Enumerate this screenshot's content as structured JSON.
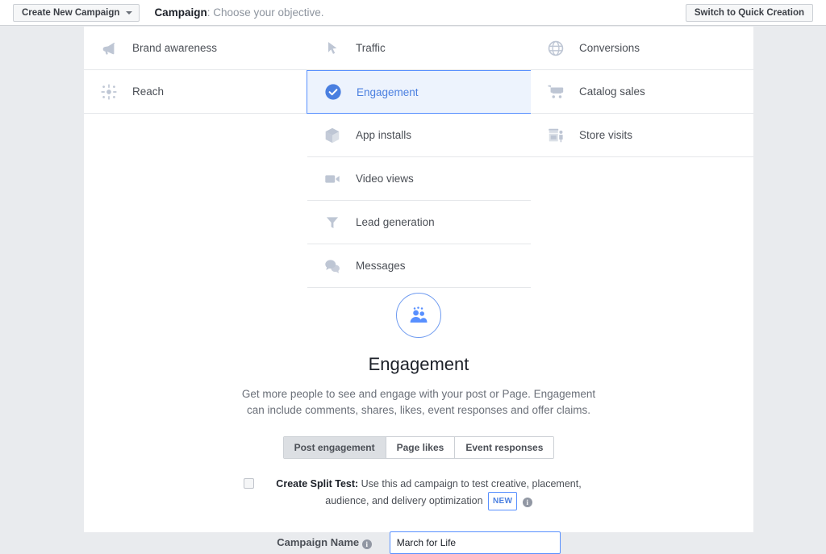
{
  "topbar": {
    "create_button": "Create New Campaign",
    "title_bold": "Campaign",
    "title_rest": ": Choose your objective.",
    "switch_button": "Switch to Quick Creation"
  },
  "objectives": {
    "column_1": [
      {
        "label": "Brand awareness",
        "icon": "megaphone-icon",
        "selected": false
      },
      {
        "label": "Reach",
        "icon": "starburst-icon",
        "selected": false
      }
    ],
    "column_2": [
      {
        "label": "Traffic",
        "icon": "cursor-icon",
        "selected": false
      },
      {
        "label": "Engagement",
        "icon": "check-circle-icon",
        "selected": true
      },
      {
        "label": "App installs",
        "icon": "cube-icon",
        "selected": false
      },
      {
        "label": "Video views",
        "icon": "video-camera-icon",
        "selected": false
      },
      {
        "label": "Lead generation",
        "icon": "funnel-icon",
        "selected": false
      },
      {
        "label": "Messages",
        "icon": "chat-bubbles-icon",
        "selected": false
      }
    ],
    "column_3": [
      {
        "label": "Conversions",
        "icon": "globe-icon",
        "selected": false
      },
      {
        "label": "Catalog sales",
        "icon": "shopping-cart-icon",
        "selected": false
      },
      {
        "label": "Store visits",
        "icon": "storefront-icon",
        "selected": false
      }
    ]
  },
  "detail": {
    "icon": "people-engagement-icon",
    "title": "Engagement",
    "description": "Get more people to see and engage with your post or Page. Engagement can include comments, shares, likes, event responses and offer claims.",
    "tabs": [
      {
        "label": "Post engagement",
        "active": true
      },
      {
        "label": "Page likes",
        "active": false
      },
      {
        "label": "Event responses",
        "active": false
      }
    ]
  },
  "split_test": {
    "checked": false,
    "label_bold": "Create Split Test:",
    "label_rest": " Use this ad campaign to test creative, placement, audience, and delivery optimization",
    "badge": "NEW",
    "info_icon": "info-icon"
  },
  "campaign_name": {
    "label": "Campaign Name",
    "info_icon": "info-icon",
    "value": "March for Life",
    "placeholder": ""
  },
  "colors": {
    "accent_blue": "#4a7fe0",
    "selected_border": "#5890ff",
    "selected_bg": "#edf3fd",
    "icon_gray": "#bec6d4",
    "page_bg": "#e9ebee"
  }
}
